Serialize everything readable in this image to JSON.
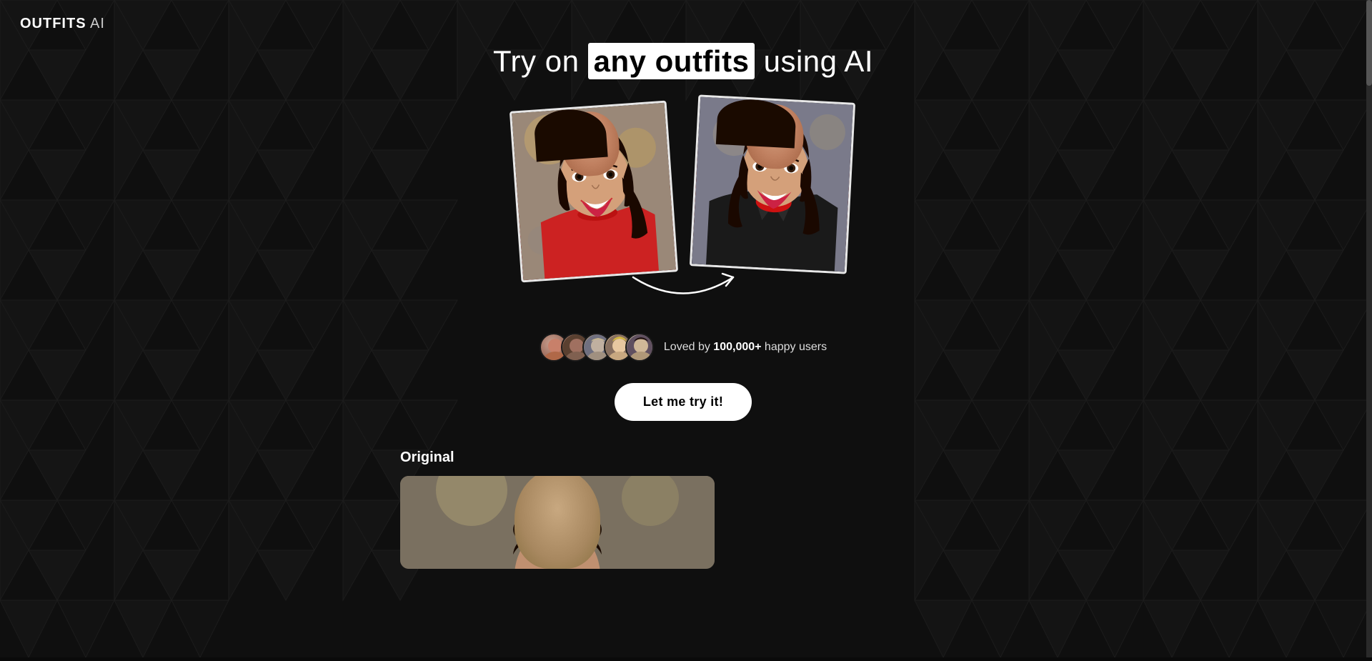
{
  "logo": {
    "brand": "OUTFITS",
    "suffix": " AI"
  },
  "hero": {
    "title_before": "Try on ",
    "title_highlight": "any outfits",
    "title_after": " using AI"
  },
  "social_proof": {
    "text_bold": "100,000+",
    "text_rest": " happy users",
    "prefix": "Loved by "
  },
  "cta": {
    "button_label": "Let me try it!"
  },
  "sections": {
    "original_label": "Original"
  }
}
